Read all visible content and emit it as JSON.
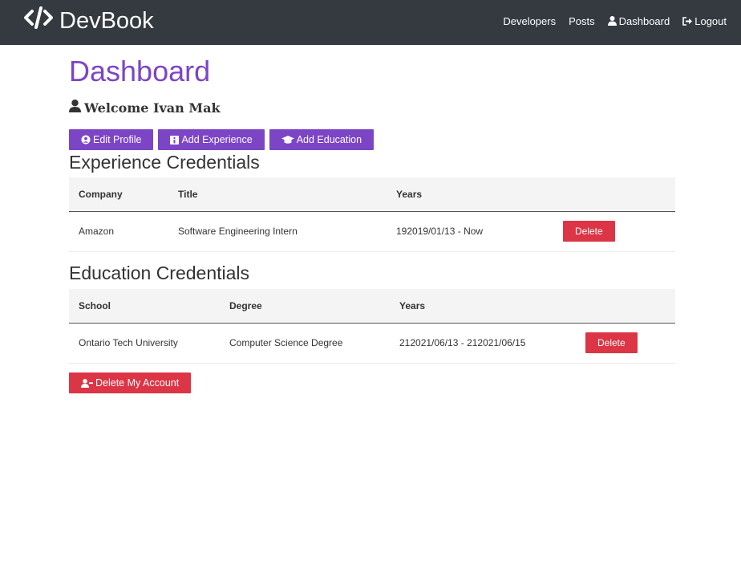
{
  "brand": {
    "name": "DevBook",
    "icon": "code-icon"
  },
  "nav": {
    "developers": "Developers",
    "posts": "Posts",
    "dashboard": "Dashboard",
    "logout": "Logout"
  },
  "page": {
    "title": "Dashboard",
    "welcome": "Welcome Ivan Mak"
  },
  "actions": {
    "edit_profile": "Edit Profile",
    "add_experience": "Add Experience",
    "add_education": "Add Education"
  },
  "experience": {
    "heading": "Experience Credentials",
    "columns": [
      "Company",
      "Title",
      "Years",
      ""
    ],
    "rows": [
      {
        "company": "Amazon",
        "title": "Software Engineering Intern",
        "years": "192019/01/13 - Now",
        "delete": "Delete"
      }
    ]
  },
  "education": {
    "heading": "Education Credentials",
    "columns": [
      "School",
      "Degree",
      "Years",
      ""
    ],
    "rows": [
      {
        "school": "Ontario Tech University",
        "degree": "Computer Science Degree",
        "years": "212021/06/13 - 212021/06/15",
        "delete": "Delete"
      }
    ]
  },
  "danger": {
    "delete_account": "Delete My Account"
  },
  "colors": {
    "primary": "#7c45c6",
    "danger": "#dc3545",
    "navbar": "#343a40"
  }
}
